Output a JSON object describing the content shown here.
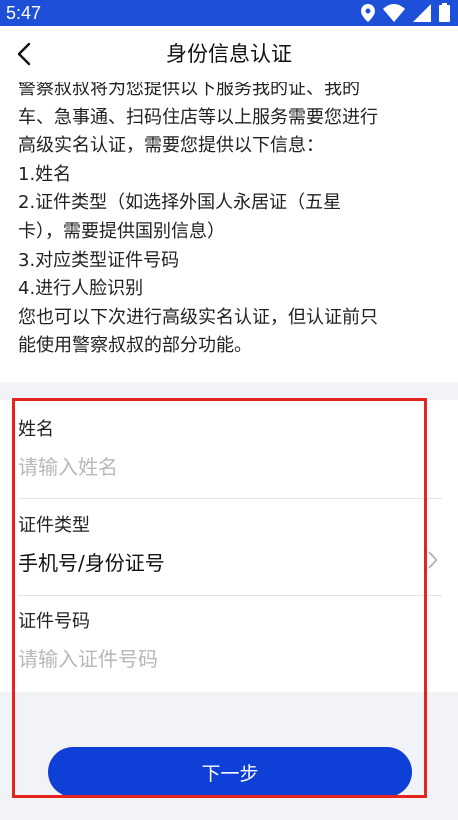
{
  "status_bar": {
    "time": "5:47",
    "icons": [
      "location-icon",
      "wifi-icon",
      "cellular-icon",
      "battery-icon"
    ]
  },
  "header": {
    "title": "身份信息认证",
    "back_icon": "back-arrow-icon"
  },
  "intro": {
    "lines": [
      "警察叔叔将为您提供以下服务我的证、我的",
      "车、急事通、扫码住店等以上服务需要您进行",
      "高级实名认证，需要您提供以下信息：",
      "1.姓名",
      "2.证件类型（如选择外国人永居证（五星",
      "卡），需要提供国别信息）",
      "3.对应类型证件号码",
      "4.进行人脸识别",
      "您也可以下次进行高级实名认证，但认证前只",
      "能使用警察叔叔的部分功能。"
    ]
  },
  "form": {
    "name_label": "姓名",
    "name_placeholder": "请输入姓名",
    "name_value": "",
    "id_type_label": "证件类型",
    "id_type_value": "手机号/身份证号",
    "id_number_label": "证件号码",
    "id_number_placeholder": "请输入证件号码",
    "id_number_value": ""
  },
  "next_button": {
    "label": "下一步"
  },
  "colors": {
    "status_bar": "#1e4fd8",
    "primary_button": "#0e3fd6",
    "highlight_border": "#e52420",
    "page_background": "#f2f3f7",
    "placeholder": "#b8b8b8"
  }
}
